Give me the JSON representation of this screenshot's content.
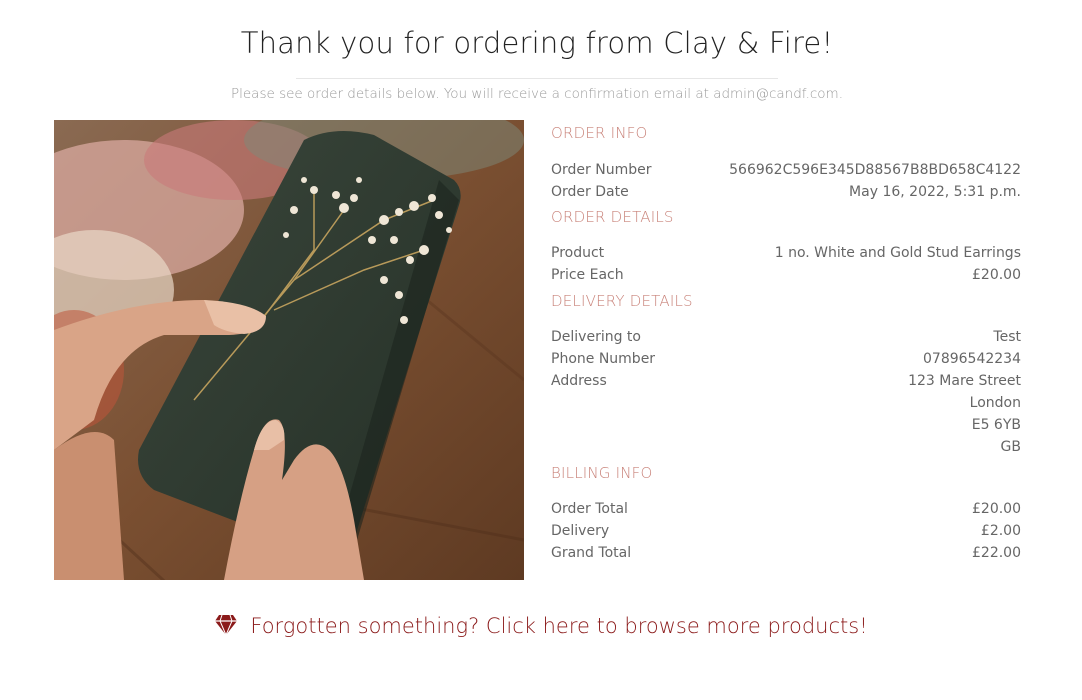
{
  "header": {
    "title": "Thank you for ordering from Clay & Fire!",
    "subtitle": "Please see order details below. You will receive a confirmation email at admin@candf.com."
  },
  "order_info": {
    "heading": "ORDER INFO",
    "order_number_label": "Order Number",
    "order_number": "566962C596E345D88567B8BD658C4122",
    "order_date_label": "Order Date",
    "order_date": "May 16, 2022, 5:31 p.m."
  },
  "order_details": {
    "heading": "ORDER DETAILS",
    "product_label": "Product",
    "product": "1 no. White and Gold Stud Earrings",
    "price_each_label": "Price Each",
    "price_each": "£20.00"
  },
  "delivery_details": {
    "heading": "DELIVERY DETAILS",
    "delivering_to_label": "Delivering to",
    "delivering_to": "Test",
    "phone_label": "Phone Number",
    "phone": "07896542234",
    "address_label": "Address",
    "address_line1": "123 Mare Street",
    "address_line2": "London",
    "address_line3": "E5 6YB",
    "address_line4": "GB"
  },
  "billing_info": {
    "heading": "BILLING INFO",
    "order_total_label": "Order Total",
    "order_total": "£20.00",
    "delivery_label": "Delivery",
    "delivery": "£2.00",
    "grand_total_label": "Grand Total",
    "grand_total": "£22.00"
  },
  "cta": {
    "text": "Forgotten something? Click here to browse more products!",
    "icon": "gem-icon",
    "color": "#8b1a1a"
  },
  "colors": {
    "heading_accent": "#c9837a",
    "gift_wrap": "#2f3a30"
  }
}
